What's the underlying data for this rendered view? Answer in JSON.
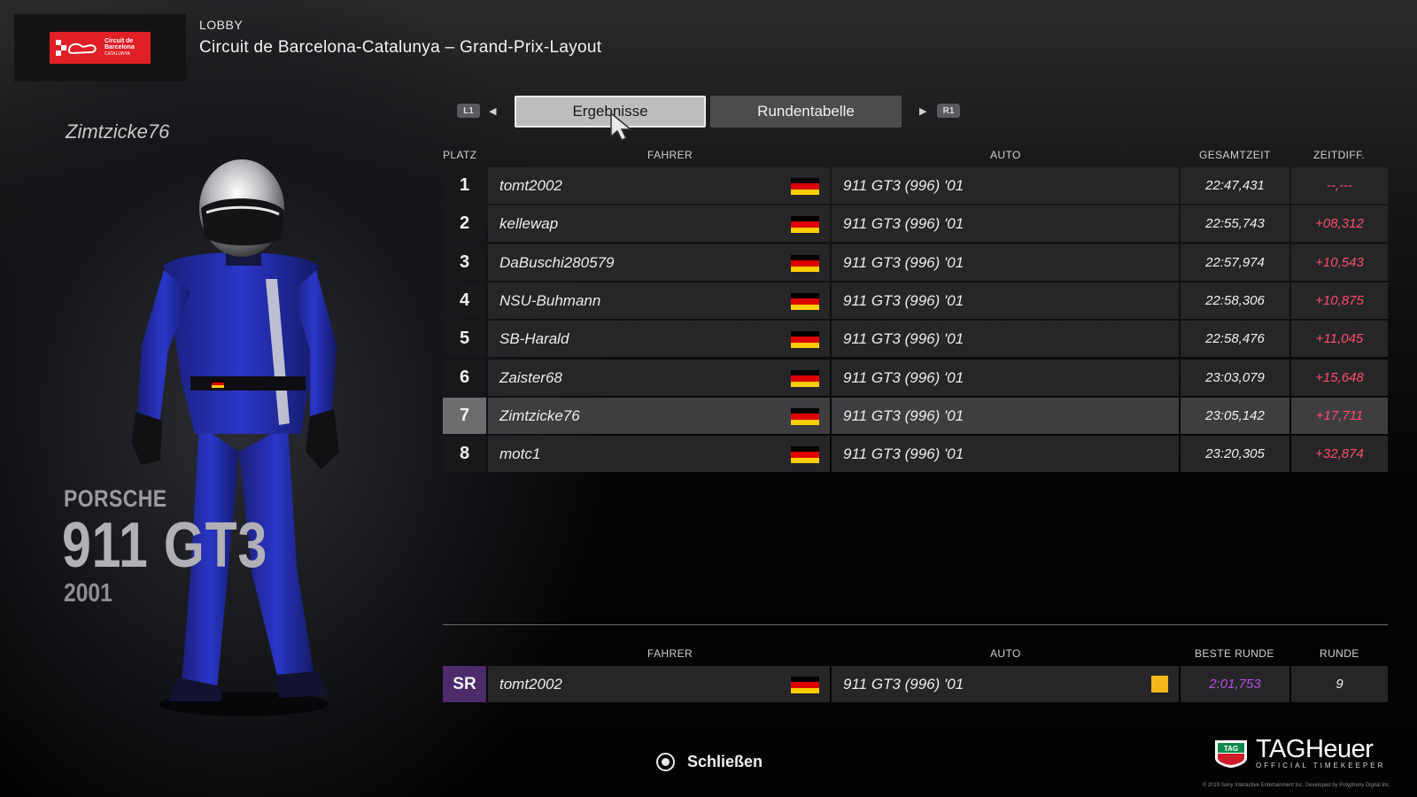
{
  "header": {
    "section": "LOBBY",
    "track": "Circuit de Barcelona-Catalunya – Grand-Prix-Layout",
    "logo_text": [
      "Circuit de",
      "Barcelona",
      "CATALUNYA"
    ]
  },
  "driver_panel": {
    "name": "Zimtzicke76",
    "car_make": "PORSCHE",
    "car_model": "911 GT3",
    "car_year": "2001"
  },
  "tabs": {
    "left_button": "L1",
    "right_button": "R1",
    "items": [
      {
        "label": "Ergebnisse",
        "active": true
      },
      {
        "label": "Rundentabelle",
        "active": false
      }
    ]
  },
  "results": {
    "columns": {
      "position": "PLATZ",
      "driver": "FAHRER",
      "car": "AUTO",
      "total_time": "GESAMTZEIT",
      "gap": "ZEITDIFF."
    },
    "rows": [
      {
        "position": "1",
        "driver": "tomt2002",
        "car": "911 GT3 (996) '01",
        "total_time": "22:47,431",
        "gap": "--,---",
        "flag": "germany"
      },
      {
        "position": "2",
        "driver": "kellewap",
        "car": "911 GT3 (996) '01",
        "total_time": "22:55,743",
        "gap": "+08,312",
        "flag": "germany"
      },
      {
        "position": "3",
        "driver": "DaBuschi280579",
        "car": "911 GT3 (996) '01",
        "total_time": "22:57,974",
        "gap": "+10,543",
        "flag": "germany"
      },
      {
        "position": "4",
        "driver": "NSU-Buhmann",
        "car": "911 GT3 (996) '01",
        "total_time": "22:58,306",
        "gap": "+10,875",
        "flag": "germany"
      },
      {
        "position": "5",
        "driver": "SB-Harald",
        "car": "911 GT3 (996) '01",
        "total_time": "22:58,476",
        "gap": "+11,045",
        "flag": "germany"
      },
      {
        "position": "6",
        "driver": "Zaister68",
        "car": "911 GT3 (996) '01",
        "total_time": "23:03,079",
        "gap": "+15,648",
        "flag": "germany"
      },
      {
        "position": "7",
        "driver": "Zimtzicke76",
        "car": "911 GT3 (996) '01",
        "total_time": "23:05,142",
        "gap": "+17,711",
        "flag": "germany",
        "highlight": true
      },
      {
        "position": "8",
        "driver": "motc1",
        "car": "911 GT3 (996) '01",
        "total_time": "23:20,305",
        "gap": "+32,874",
        "flag": "germany"
      }
    ]
  },
  "fastest_lap": {
    "columns": {
      "driver": "FAHRER",
      "car": "AUTO",
      "best_lap": "BESTE RUNDE",
      "lap": "RUNDE"
    },
    "tag": "SR",
    "driver": "tomt2002",
    "car": "911 GT3 (996) '01",
    "best_lap": "2:01,753",
    "lap": "9",
    "flag": "germany"
  },
  "footer": {
    "close_label": "Schließen",
    "brand": "TAGHeuer",
    "brand_sub": "OFFICIAL TIMEKEEPER",
    "copyright": "© 2019 Sony Interactive Entertainment Inc. Developed by Polyphony Digital Inc."
  },
  "colors": {
    "gap_text": "#ff4d6a",
    "best_lap_text": "#b64ee6",
    "sr_badge": "#4d2a6a",
    "tyre_indicator": "#f2b81c",
    "flag_de": [
      "#000000",
      "#dd0000",
      "#ffce00"
    ]
  },
  "icons": {
    "close": "circle-button-icon",
    "prev": "triangle-left-icon",
    "next": "triangle-right-icon",
    "cursor": "mouse-pointer-icon"
  }
}
